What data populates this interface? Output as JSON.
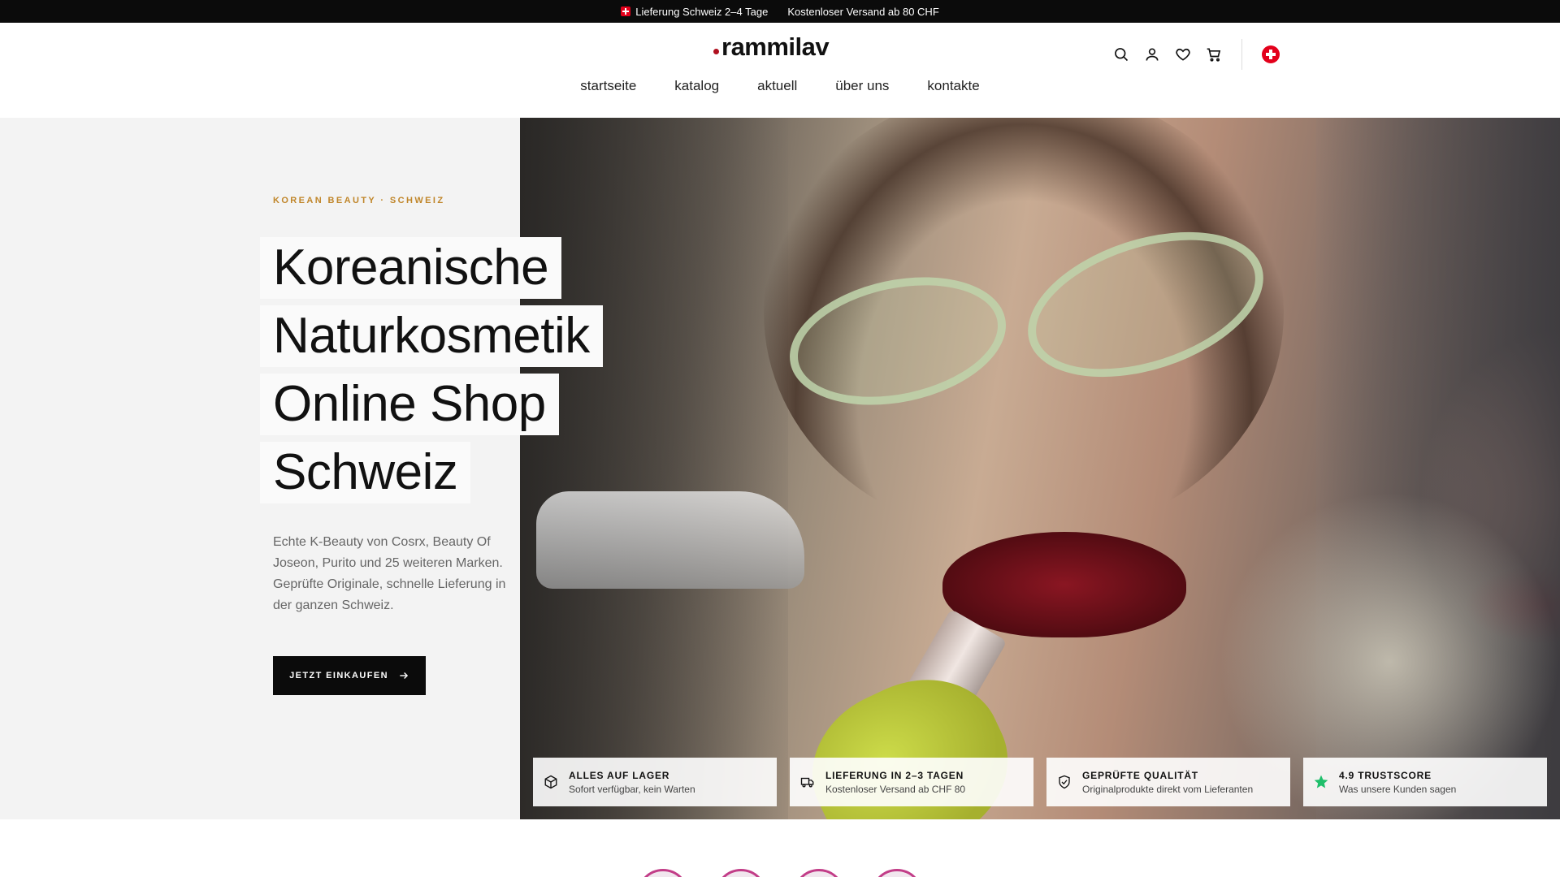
{
  "topbar": {
    "shipping": "Lieferung Schweiz 2–4 Tage",
    "free_shipping": "Kostenloser Versand ab 80 CHF"
  },
  "header": {
    "logo": "rammilav",
    "nav": [
      "startseite",
      "katalog",
      "aktuell",
      "über uns",
      "kontakte"
    ],
    "icons": [
      "search-icon",
      "user-icon",
      "heart-icon",
      "cart-icon",
      "swiss-flag-icon"
    ]
  },
  "hero": {
    "eyebrow": "KOREAN BEAUTY · SCHWEIZ",
    "headline": [
      "Koreanische",
      "Naturkosmetik",
      "Online Shop",
      "Schweiz"
    ],
    "intro": "Echte K-Beauty von Cosrx, Beauty Of Joseon, Purito und 25 weiteren Marken. Geprüfte Originale, schnelle Lieferung in der ganzen Schweiz.",
    "cta": "JETZT EINKAUFEN"
  },
  "features": [
    {
      "icon": "box-icon",
      "title": "ALLES AUF LAGER",
      "subtitle": "Sofort verfügbar, kein Warten"
    },
    {
      "icon": "truck-icon",
      "title": "LIEFERUNG IN 2–3 TAGEN",
      "subtitle": "Kostenloser Versand ab CHF 80"
    },
    {
      "icon": "shield-check-icon",
      "title": "GEPRÜFTE QUALITÄT",
      "subtitle": "Originalprodukte direkt vom Lieferanten"
    },
    {
      "icon": "star-icon",
      "title": "4.9 TRUSTSCORE",
      "subtitle": "Was unsere Kunden sagen"
    }
  ],
  "colors": {
    "accent": "#c0862a",
    "brand_dot": "#b0101f",
    "swiss_red": "#e3001b",
    "trust_green": "#1fbf6b"
  }
}
